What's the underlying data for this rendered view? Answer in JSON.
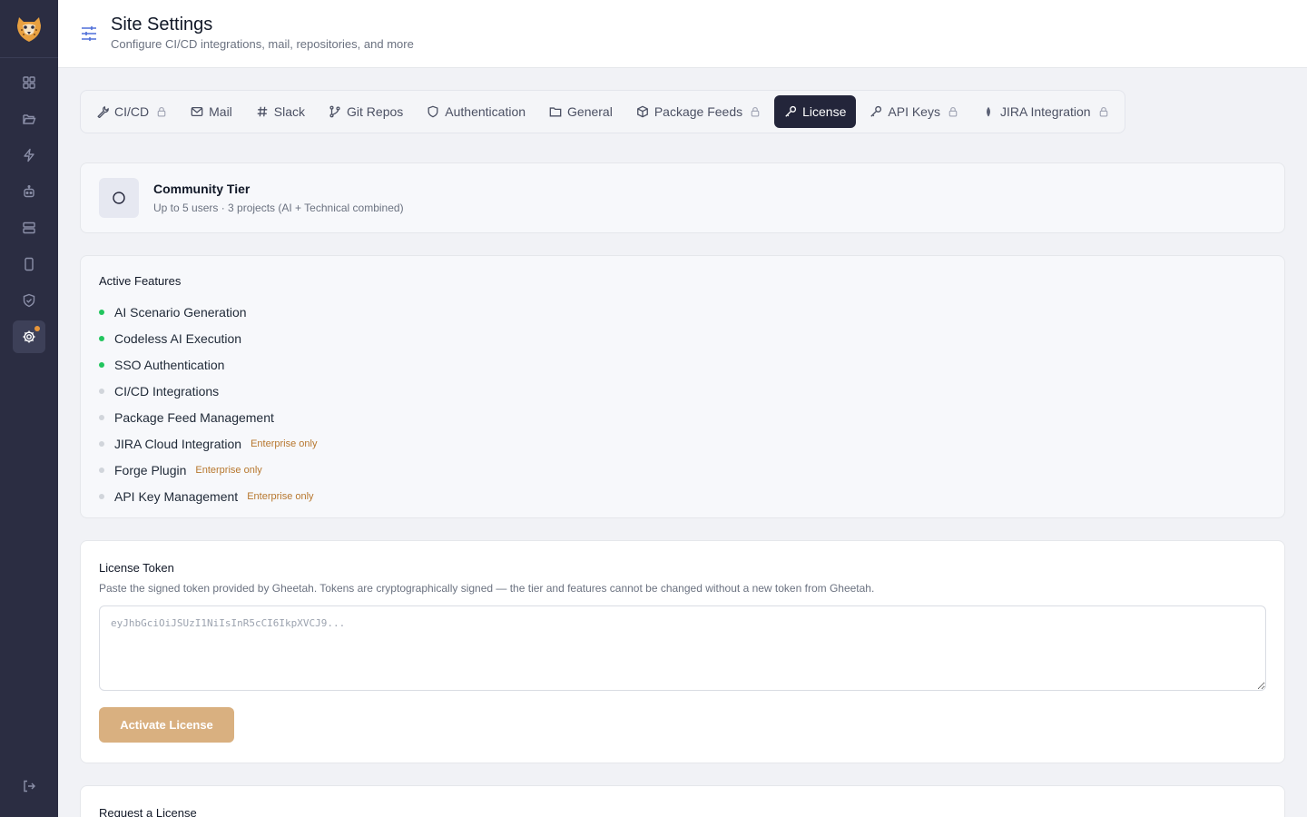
{
  "header": {
    "title": "Site Settings",
    "subtitle": "Configure CI/CD integrations, mail, repositories, and more"
  },
  "sidebar": {
    "items": [
      {
        "icon": "dashboard-icon"
      },
      {
        "icon": "folder-icon"
      },
      {
        "icon": "lightning-icon"
      },
      {
        "icon": "robot-icon"
      },
      {
        "icon": "server-icon"
      },
      {
        "icon": "mobile-icon"
      },
      {
        "icon": "shield-check-icon"
      },
      {
        "icon": "gear-icon",
        "active": true,
        "notification": true
      }
    ],
    "bottom": {
      "icon": "logout-icon"
    }
  },
  "tabs": [
    {
      "label": "CI/CD",
      "icon": "wrench-icon",
      "locked": true
    },
    {
      "label": "Mail",
      "icon": "mail-icon",
      "locked": false
    },
    {
      "label": "Slack",
      "icon": "hash-icon",
      "locked": false
    },
    {
      "label": "Git Repos",
      "icon": "git-branch-icon",
      "locked": false
    },
    {
      "label": "Authentication",
      "icon": "shield-icon",
      "locked": false
    },
    {
      "label": "General",
      "icon": "folder-icon",
      "locked": false
    },
    {
      "label": "Package Feeds",
      "icon": "package-icon",
      "locked": true
    },
    {
      "label": "License",
      "icon": "key-icon",
      "locked": false,
      "active": true
    },
    {
      "label": "API Keys",
      "icon": "key-icon",
      "locked": true
    },
    {
      "label": "JIRA Integration",
      "icon": "jira-icon",
      "locked": true
    }
  ],
  "tier": {
    "name": "Community Tier",
    "description": "Up to 5 users · 3 projects (AI + Technical combined)"
  },
  "features": {
    "title": "Active Features",
    "items": [
      {
        "label": "AI Scenario Generation",
        "active": true,
        "badge": ""
      },
      {
        "label": "Codeless AI Execution",
        "active": true,
        "badge": ""
      },
      {
        "label": "SSO Authentication",
        "active": true,
        "badge": ""
      },
      {
        "label": "CI/CD Integrations",
        "active": false,
        "badge": ""
      },
      {
        "label": "Package Feed Management",
        "active": false,
        "badge": ""
      },
      {
        "label": "JIRA Cloud Integration",
        "active": false,
        "badge": "Enterprise only"
      },
      {
        "label": "Forge Plugin",
        "active": false,
        "badge": "Enterprise only"
      },
      {
        "label": "API Key Management",
        "active": false,
        "badge": "Enterprise only"
      }
    ]
  },
  "token": {
    "title": "License Token",
    "description": "Paste the signed token provided by Gheetah. Tokens are cryptographically signed — the tier and features cannot be changed without a new token from Gheetah.",
    "placeholder": "eyJhbGciOiJSUzI1NiIsInR5cCI6IkpXVCJ9...",
    "value": "",
    "button_label": "Activate License"
  },
  "request": {
    "title": "Request a License"
  },
  "colors": {
    "sidebar_bg": "#2b2d42",
    "active_tab": "#23253a",
    "accent_button": "#d9b080",
    "feature_on": "#22c55e",
    "enterprise_badge": "#b7772e"
  }
}
